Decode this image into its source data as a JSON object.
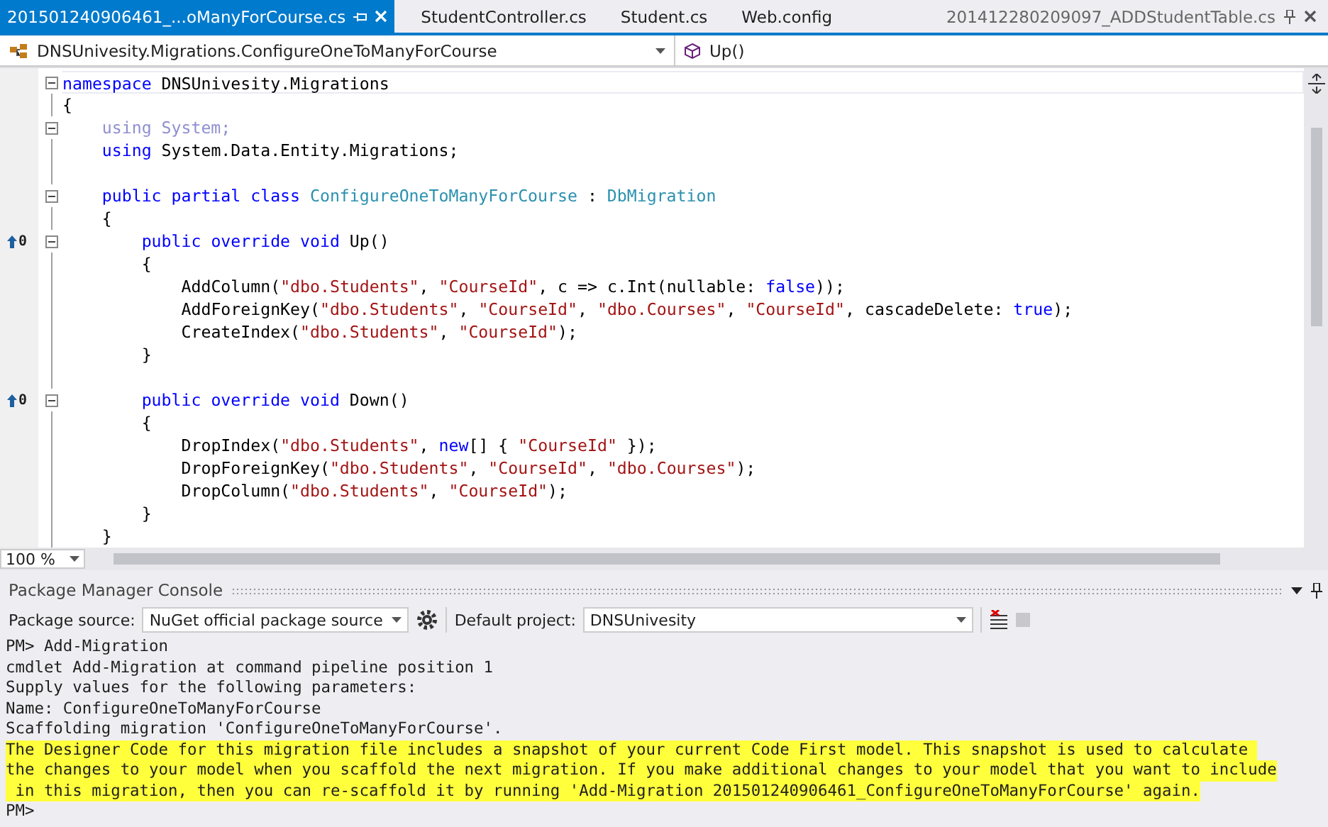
{
  "tabs": [
    {
      "label": "201501240906461_...oManyForCourse.cs",
      "selected": true,
      "pinned": false
    },
    {
      "label": "StudentController.cs",
      "selected": false,
      "pinned": false
    },
    {
      "label": "Student.cs",
      "selected": false,
      "pinned": false
    },
    {
      "label": "Web.config",
      "selected": false,
      "pinned": false
    },
    {
      "label": "201412280209097_ADDStudentTable.cs",
      "selected": false,
      "pinned": true
    }
  ],
  "navigation": {
    "type_dropdown": "DNSUnivesity.Migrations.ConfigureOneToManyForCourse",
    "member_dropdown": "Up()"
  },
  "editor": {
    "lines": [
      {
        "kind": "code",
        "expanded": true,
        "segments": [
          {
            "kind": "keyword",
            "text": "namespace"
          },
          {
            "kind": "plain",
            "text": " DNSUnivesity.Migrations"
          }
        ]
      },
      {
        "kind": "code",
        "segments": [
          {
            "kind": "plain",
            "text": "{"
          }
        ],
        "children": [
          {
            "kind": "code",
            "expanded": true,
            "segments": [
              {
                "kind": "unused",
                "text": "using System;"
              }
            ]
          },
          {
            "kind": "code",
            "segments": [
              {
                "kind": "keyword",
                "text": "using"
              },
              {
                "kind": "plain",
                "text": " System.Data.Entity.Migrations;"
              }
            ]
          },
          {
            "kind": "blank"
          },
          {
            "kind": "code",
            "expanded": true,
            "segments": [
              {
                "kind": "keyword",
                "text": "public partial class"
              },
              {
                "kind": "type",
                "text": " ConfigureOneToManyForCourse"
              },
              {
                "kind": "plain",
                "text": " : "
              },
              {
                "kind": "type",
                "text": "DbMigration"
              }
            ]
          },
          {
            "kind": "code",
            "segments": [
              {
                "kind": "plain",
                "text": "{"
              }
            ],
            "children": [
              {
                "kind": "code",
                "expanded": true,
                "references": "0",
                "segments": [
                  {
                    "kind": "keyword",
                    "text": "public override void"
                  },
                  {
                    "kind": "plain",
                    "text": " Up()"
                  }
                ]
              },
              {
                "kind": "code",
                "segments": [
                  {
                    "kind": "plain",
                    "text": "{"
                  }
                ],
                "children": [
                  {
                    "kind": "code",
                    "segments": [
                      {
                        "kind": "plain",
                        "text": "AddColumn("
                      },
                      {
                        "kind": "string",
                        "text": "\"dbo.Students\""
                      },
                      {
                        "kind": "plain",
                        "text": ", "
                      },
                      {
                        "kind": "string",
                        "text": "\"CourseId\""
                      },
                      {
                        "kind": "plain",
                        "text": ", c => c.Int(nullable: "
                      },
                      {
                        "kind": "keyword",
                        "text": "false"
                      },
                      {
                        "kind": "plain",
                        "text": "));"
                      }
                    ]
                  },
                  {
                    "kind": "code",
                    "segments": [
                      {
                        "kind": "plain",
                        "text": "AddForeignKey("
                      },
                      {
                        "kind": "string",
                        "text": "\"dbo.Students\""
                      },
                      {
                        "kind": "plain",
                        "text": ", "
                      },
                      {
                        "kind": "string",
                        "text": "\"CourseId\""
                      },
                      {
                        "kind": "plain",
                        "text": ", "
                      },
                      {
                        "kind": "string",
                        "text": "\"dbo.Courses\""
                      },
                      {
                        "kind": "plain",
                        "text": ", "
                      },
                      {
                        "kind": "string",
                        "text": "\"CourseId\""
                      },
                      {
                        "kind": "plain",
                        "text": ", cascadeDelete: "
                      },
                      {
                        "kind": "keyword",
                        "text": "true"
                      },
                      {
                        "kind": "plain",
                        "text": ");"
                      }
                    ]
                  },
                  {
                    "kind": "code",
                    "segments": [
                      {
                        "kind": "plain",
                        "text": "CreateIndex("
                      },
                      {
                        "kind": "string",
                        "text": "\"dbo.Students\""
                      },
                      {
                        "kind": "plain",
                        "text": ", "
                      },
                      {
                        "kind": "string",
                        "text": "\"CourseId\""
                      },
                      {
                        "kind": "plain",
                        "text": ");"
                      }
                    ]
                  }
                ]
              },
              {
                "kind": "code",
                "segments": [
                  {
                    "kind": "plain",
                    "text": "}"
                  }
                ]
              },
              {
                "kind": "blank"
              },
              {
                "kind": "code",
                "expanded": true,
                "references": "0",
                "segments": [
                  {
                    "kind": "keyword",
                    "text": "public override void"
                  },
                  {
                    "kind": "plain",
                    "text": " Down()"
                  }
                ]
              },
              {
                "kind": "code",
                "segments": [
                  {
                    "kind": "plain",
                    "text": "{"
                  }
                ],
                "children": [
                  {
                    "kind": "code",
                    "segments": [
                      {
                        "kind": "plain",
                        "text": "DropIndex("
                      },
                      {
                        "kind": "string",
                        "text": "\"dbo.Students\""
                      },
                      {
                        "kind": "plain",
                        "text": ", "
                      },
                      {
                        "kind": "keyword",
                        "text": "new"
                      },
                      {
                        "kind": "plain",
                        "text": "[] { "
                      },
                      {
                        "kind": "string",
                        "text": "\"CourseId\""
                      },
                      {
                        "kind": "plain",
                        "text": " });"
                      }
                    ]
                  },
                  {
                    "kind": "code",
                    "segments": [
                      {
                        "kind": "plain",
                        "text": "DropForeignKey("
                      },
                      {
                        "kind": "string",
                        "text": "\"dbo.Students\""
                      },
                      {
                        "kind": "plain",
                        "text": ", "
                      },
                      {
                        "kind": "string",
                        "text": "\"CourseId\""
                      },
                      {
                        "kind": "plain",
                        "text": ", "
                      },
                      {
                        "kind": "string",
                        "text": "\"dbo.Courses\""
                      },
                      {
                        "kind": "plain",
                        "text": ");"
                      }
                    ]
                  },
                  {
                    "kind": "code",
                    "segments": [
                      {
                        "kind": "plain",
                        "text": "DropColumn("
                      },
                      {
                        "kind": "string",
                        "text": "\"dbo.Students\""
                      },
                      {
                        "kind": "plain",
                        "text": ", "
                      },
                      {
                        "kind": "string",
                        "text": "\"CourseId\""
                      },
                      {
                        "kind": "plain",
                        "text": ");"
                      }
                    ]
                  }
                ]
              },
              {
                "kind": "code",
                "segments": [
                  {
                    "kind": "plain",
                    "text": "}"
                  }
                ]
              }
            ]
          },
          {
            "kind": "code",
            "segments": [
              {
                "kind": "plain",
                "text": "}"
              }
            ]
          }
        ]
      }
    ],
    "zoom": "100 %"
  },
  "console": {
    "title": "Package Manager Console",
    "package_source_label": "Package source:",
    "package_source": "NuGet official package source",
    "default_project_label": "Default project:",
    "default_project": "DNSUnivesity",
    "lines": [
      {
        "kind": "output",
        "text": "PM> Add-Migration"
      },
      {
        "kind": "output",
        "text": "cmdlet Add-Migration at command pipeline position 1"
      },
      {
        "kind": "output",
        "text": "Supply values for the following parameters:"
      },
      {
        "kind": "output",
        "text": "Name: ConfigureOneToManyForCourse"
      },
      {
        "kind": "output",
        "text": "Scaffolding migration 'ConfigureOneToManyForCourse'."
      },
      {
        "kind": "warning",
        "text": "The Designer Code for this migration file includes a snapshot of your current Code First model. This snapshot is used to calculate "
      },
      {
        "kind": "warning",
        "text": "the changes to your model when you scaffold the next migration. If you make additional changes to your model that you want to include"
      },
      {
        "kind": "warning",
        "text": " in this migration, then you can re-scaffold it by running 'Add-Migration 201501240906461_ConfigureOneToManyForCourse' again."
      },
      {
        "kind": "output",
        "text": "PM>"
      }
    ]
  }
}
